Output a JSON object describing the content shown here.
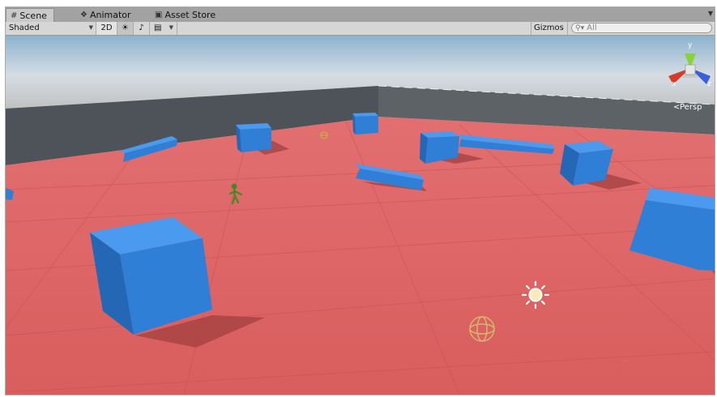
{
  "tabs": [
    {
      "label": "Scene",
      "icon": "scene-grid-icon",
      "active": true
    },
    {
      "label": "Animator",
      "icon": "animator-icon",
      "active": false
    },
    {
      "label": "Asset Store",
      "icon": "asset-store-icon",
      "active": false
    }
  ],
  "toolbar": {
    "shading_mode": "Shaded",
    "mode_2d": "2D",
    "gizmos_label": "Gizmos",
    "search_placeholder": "All"
  },
  "scene_gizmo": {
    "projection_label": "Persp",
    "axis_y": "y",
    "axis_x": "x",
    "axis_z": "z"
  },
  "colors": {
    "ground": "#dd6362",
    "wall": "#555a5e",
    "cube": "#2f7fd6",
    "sky_top": "#8cb1cc",
    "tab_bar": "#a2a2a2"
  }
}
